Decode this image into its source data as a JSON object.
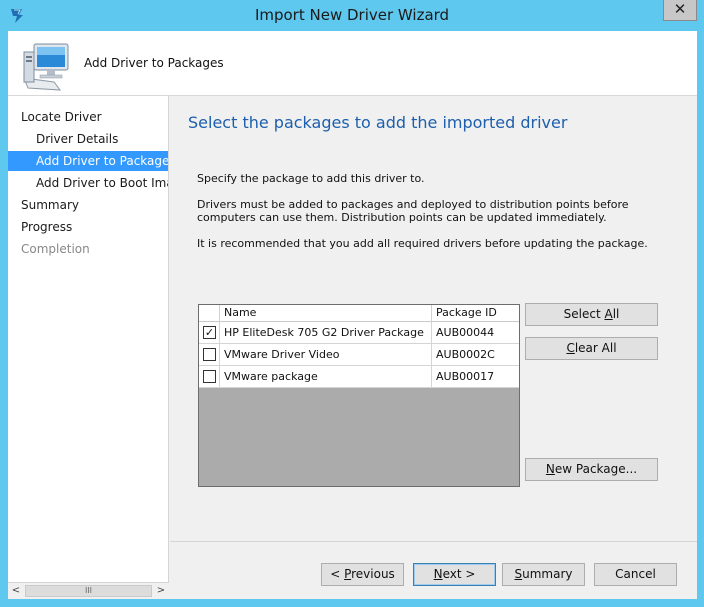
{
  "window": {
    "title": "Import New Driver Wizard",
    "close_glyph": "✕"
  },
  "header": {
    "title": "Add Driver to Packages",
    "icon": "computer-icon"
  },
  "nav": {
    "items": [
      {
        "label": "Locate Driver",
        "level": 1,
        "state": "normal"
      },
      {
        "label": "Driver Details",
        "level": 2,
        "state": "normal"
      },
      {
        "label": "Add Driver to Packages",
        "level": 2,
        "state": "selected"
      },
      {
        "label": "Add Driver to Boot Images",
        "level": 2,
        "state": "normal"
      },
      {
        "label": "Summary",
        "level": 1,
        "state": "normal"
      },
      {
        "label": "Progress",
        "level": 1,
        "state": "normal"
      },
      {
        "label": "Completion",
        "level": 1,
        "state": "disabled"
      }
    ],
    "scroll_left": "<",
    "scroll_right": ">",
    "scroll_grip": "III"
  },
  "main": {
    "heading": "Select the packages to add the imported driver",
    "instruction": "Specify the package to add this driver to.",
    "info": "Drivers must be added to packages and deployed to distribution points before computers can use them.  Distribution points can be updated immediately.",
    "recommendation": "It is recommended that you add all required drivers before updating the package."
  },
  "grid": {
    "columns": [
      "Name",
      "Package ID"
    ],
    "rows": [
      {
        "checked": true,
        "name": "HP EliteDesk 705 G2 Driver Package",
        "package_id": "AUB00044"
      },
      {
        "checked": false,
        "name": "VMware Driver Video",
        "package_id": "AUB0002C"
      },
      {
        "checked": false,
        "name": "VMware package",
        "package_id": "AUB00017"
      }
    ]
  },
  "side_buttons": {
    "select_all_pre": "Select ",
    "select_all_key": "A",
    "select_all_post": "ll",
    "clear_all_key": "C",
    "clear_all_post": "lear All",
    "new_package_key": "N",
    "new_package_post": "ew Package..."
  },
  "footer": {
    "previous_pre": "< ",
    "previous_key": "P",
    "previous_post": "revious",
    "next_key": "N",
    "next_post": "ext >",
    "summary_key": "S",
    "summary_post": "ummary",
    "cancel": "Cancel"
  },
  "colors": {
    "titlebar": "#5ec8ef",
    "selection": "#3399ff",
    "heading": "#1d5fad"
  }
}
